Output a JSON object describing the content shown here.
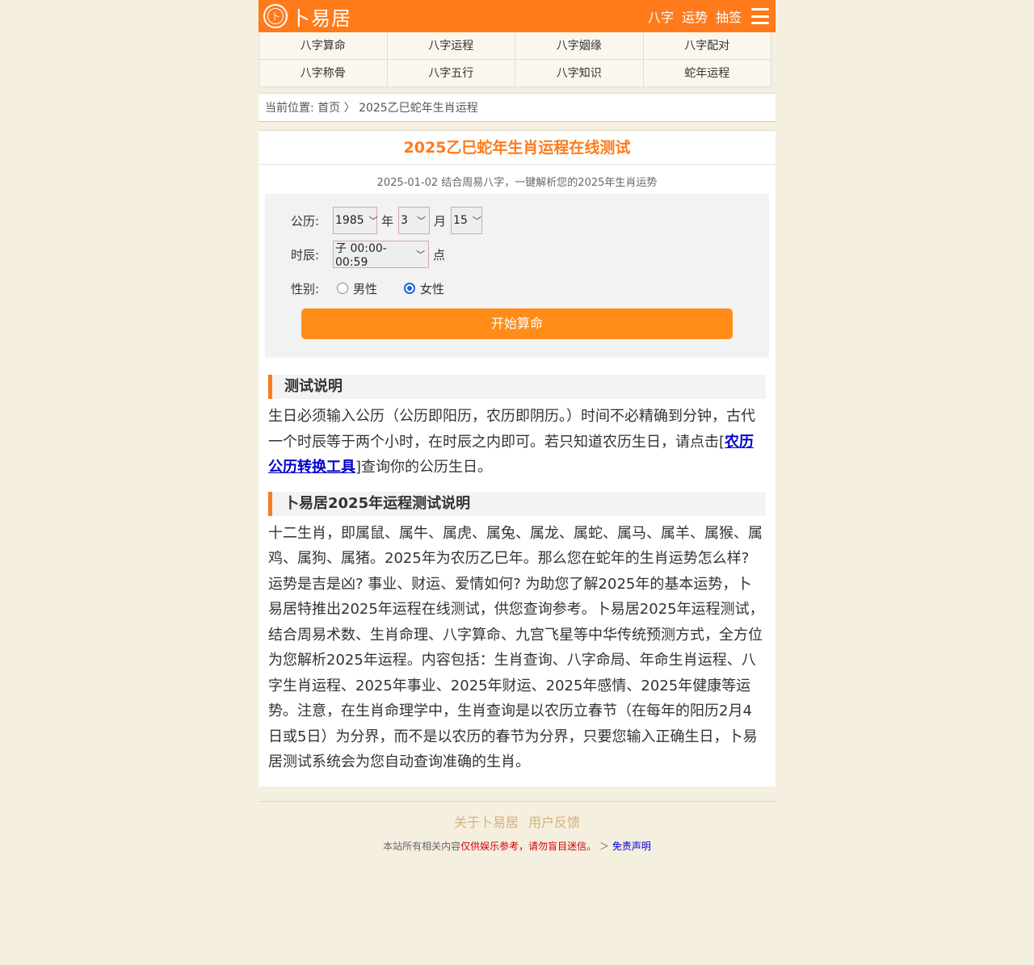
{
  "header": {
    "logo_glyph": "卜",
    "logo_text": "卜易居",
    "nav": [
      "八字",
      "运势",
      "抽签"
    ]
  },
  "navgrid": [
    "八字算命",
    "八字运程",
    "八字姻缘",
    "八字配对",
    "八字称骨",
    "八字五行",
    "八字知识",
    "蛇年运程"
  ],
  "breadcrumb": {
    "prefix": "当前位置: ",
    "home": "首页",
    "sep": " 〉",
    "current": "2025乙巳蛇年生肖运程"
  },
  "main": {
    "title": "2025乙巳蛇年生肖运程在线测试",
    "subline": "2025-01-02 结合周易八字，一键解析您的2025年生肖运势"
  },
  "form": {
    "solar_label": "公历:",
    "year_value": "1985",
    "year_unit": "年",
    "month_value": "3",
    "month_unit": "月",
    "day_value": "15",
    "hour_label": "时辰:",
    "hour_value": "子 00:00-00:59",
    "hour_unit": "点",
    "gender_label": "性别:",
    "male": "男性",
    "female": "女性",
    "selected_gender": "女性",
    "submit": "开始算命"
  },
  "section1": {
    "heading": "测试说明",
    "text_a": "生日必须输入公历（公历即阳历，农历即阴历。）时间不必精确到分钟，古代一个时辰等于两个小时，在时辰之内即可。若只知道农历生日，请点击[",
    "link": "农历公历转换工具",
    "text_b": "]查询你的公历生日。"
  },
  "section2": {
    "heading": "卜易居2025年运程测试说明",
    "text": "十二生肖，即属鼠、属牛、属虎、属兔、属龙、属蛇、属马、属羊、属猴、属鸡、属狗、属猪。2025年为农历乙巳年。那么您在蛇年的生肖运势怎么样? 运势是吉是凶? 事业、财运、爱情如何? 为助您了解2025年的基本运势，卜易居特推出2025年运程在线测试，供您查询参考。卜易居2025年运程测试，结合周易术数、生肖命理、八字算命、九宫飞星等中华传统预测方式，全方位为您解析2025年运程。内容包括：生肖查询、八字命局、年命生肖运程、八字生肖运程、2025年事业、2025年财运、2025年感情、2025年健康等运势。注意，在生肖命理学中，生肖查询是以农历立春节（在每年的阳历2月4日或5日）为分界，而不是以农历的春节为分界，只要您输入正确生日，卜易居测试系统会为您自动查询准确的生肖。"
  },
  "footer": {
    "link_about": "关于卜易居",
    "link_feedback": "用户反馈",
    "note_a": "本站所有相关内容",
    "note_red": "仅供娱乐参考，请勿盲目迷信。",
    "note_arrow": " ＞ ",
    "note_link": "免责声明"
  },
  "colors": {
    "brand": "#ff7a1a",
    "button": "#ff8c17",
    "background": "#f5efe0"
  }
}
